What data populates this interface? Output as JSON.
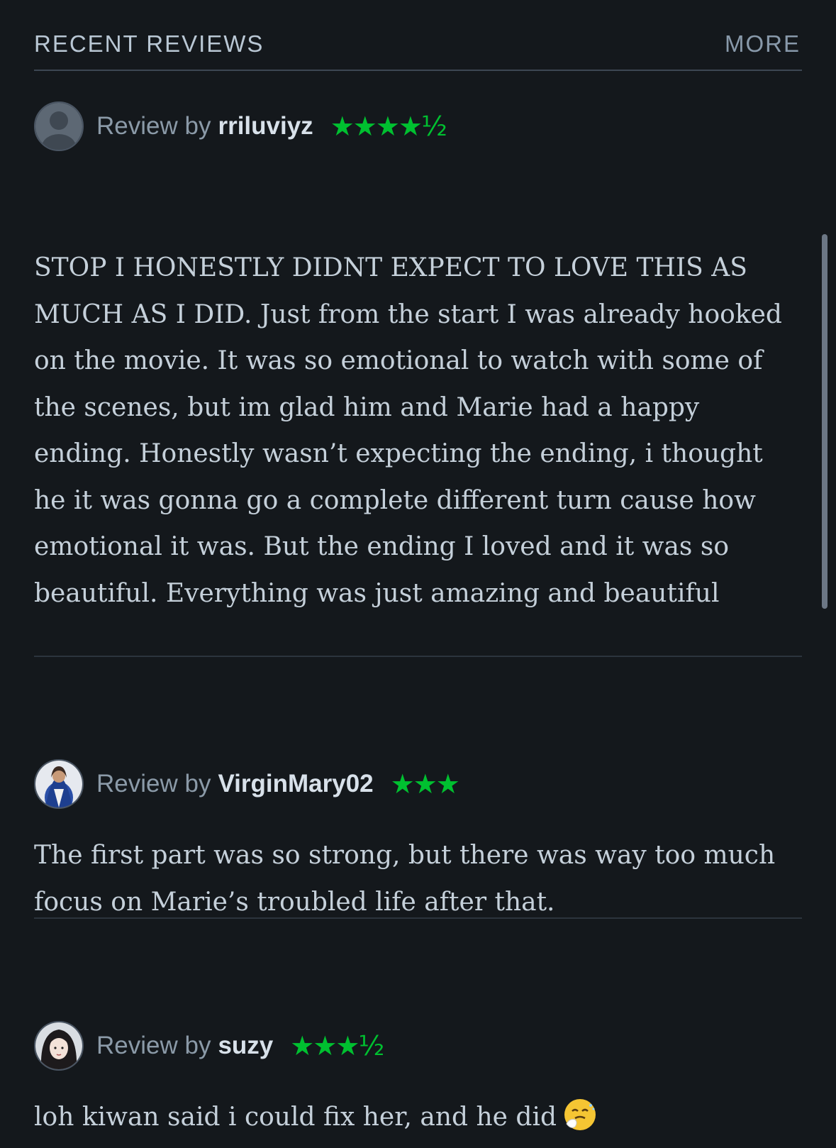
{
  "section": {
    "title": "RECENT REVIEWS",
    "more_label": "MORE"
  },
  "reviews": [
    {
      "review_by": "Review by",
      "username": "rriluviyz",
      "stars": "★★★★½",
      "rating": 4.5,
      "text": "STOP I HONESTLY DIDNT EXPECT TO LOVE THIS AS MUCH AS I DID. Just from the start I was already hooked on the movie. It was so emotional to watch with some of the scenes, but im glad him and Marie had a happy ending. Honestly wasn’t expecting the ending, i thought he it was gonna go a complete different turn cause how emotional it was. But the ending I loved and it was so beautiful. Everything was just amazing and beautiful",
      "avatar": "default-avatar-icon"
    },
    {
      "review_by": "Review by",
      "username": "VirginMary02",
      "stars": "★★★",
      "rating": 3,
      "text": "The first part was so strong, but there was way too much focus on Marie’s troubled life after that.",
      "avatar": "user-photo"
    },
    {
      "review_by": "Review by",
      "username": "suzy",
      "stars": "★★★½",
      "rating": 3.5,
      "text": "loh kiwan said i could fix her, and he did",
      "avatar": "user-photo",
      "emoji": "sneezing-face-emoji"
    }
  ],
  "colors": {
    "background": "#14181c",
    "star_green": "#00c030",
    "body_text": "#c5d0da",
    "muted": "#8b9aa8"
  }
}
